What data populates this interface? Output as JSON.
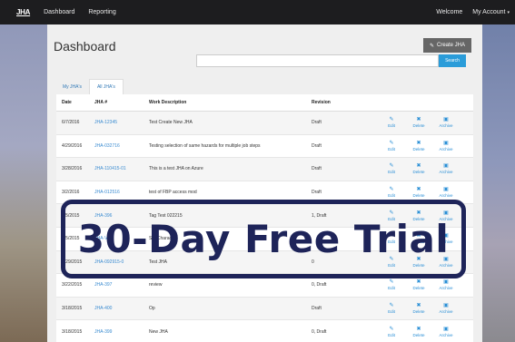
{
  "nav": {
    "brand": "JHA",
    "links": [
      "Dashboard",
      "Reporting"
    ],
    "welcome": "Welcome",
    "account": "My Account",
    "caret": "▾"
  },
  "page": {
    "title": "Dashboard",
    "create_label": "Create JHA",
    "search_placeholder": "",
    "search_button": "Search"
  },
  "tabs": [
    "My JHA's",
    "All JHA's"
  ],
  "table": {
    "headers": [
      "Date",
      "JHA #",
      "Work Description",
      "Revision"
    ],
    "action_labels": [
      "Edit",
      "Delete",
      "Archive"
    ],
    "rows": [
      {
        "date": "6/7/2016",
        "jha": "JHA-12345",
        "desc": "Test Create New JHA",
        "rev": "Draft"
      },
      {
        "date": "4/29/2016",
        "jha": "JHA-032716",
        "desc": "Testing selection of same hazards for multiple job steps",
        "rev": "Draft"
      },
      {
        "date": "3/28/2016",
        "jha": "JHA-110415-01",
        "desc": "This is a test JHA on Azure",
        "rev": "Draft"
      },
      {
        "date": "3/2/2016",
        "jha": "JHA-012516",
        "desc": "test of FBP access mod",
        "rev": "Draft"
      },
      {
        "date": "1/5/2015",
        "jha": "JHA-396",
        "desc": "Tag Test 022215",
        "rev": "1, Draft"
      },
      {
        "date": "1/5/2015",
        "jha": "JHA-V2",
        "desc": "Set Character",
        "rev": ""
      },
      {
        "date": "4/29/2015",
        "jha": "JHA-092915-0",
        "desc": "Test JHA",
        "rev": "0"
      },
      {
        "date": "3/22/2015",
        "jha": "JHA-397",
        "desc": "review",
        "rev": "0, Draft"
      },
      {
        "date": "3/18/2015",
        "jha": "JHA-400",
        "desc": "Op",
        "rev": "Draft"
      },
      {
        "date": "3/18/2015",
        "jha": "JHA-399",
        "desc": "New JHA",
        "rev": "0, Draft"
      }
    ]
  },
  "overlay": {
    "text": "30-Day Free Trial"
  },
  "colors": {
    "accent": "#2a9cd9",
    "navbar": "#1d1d1f",
    "overlay": "#1e2459"
  }
}
